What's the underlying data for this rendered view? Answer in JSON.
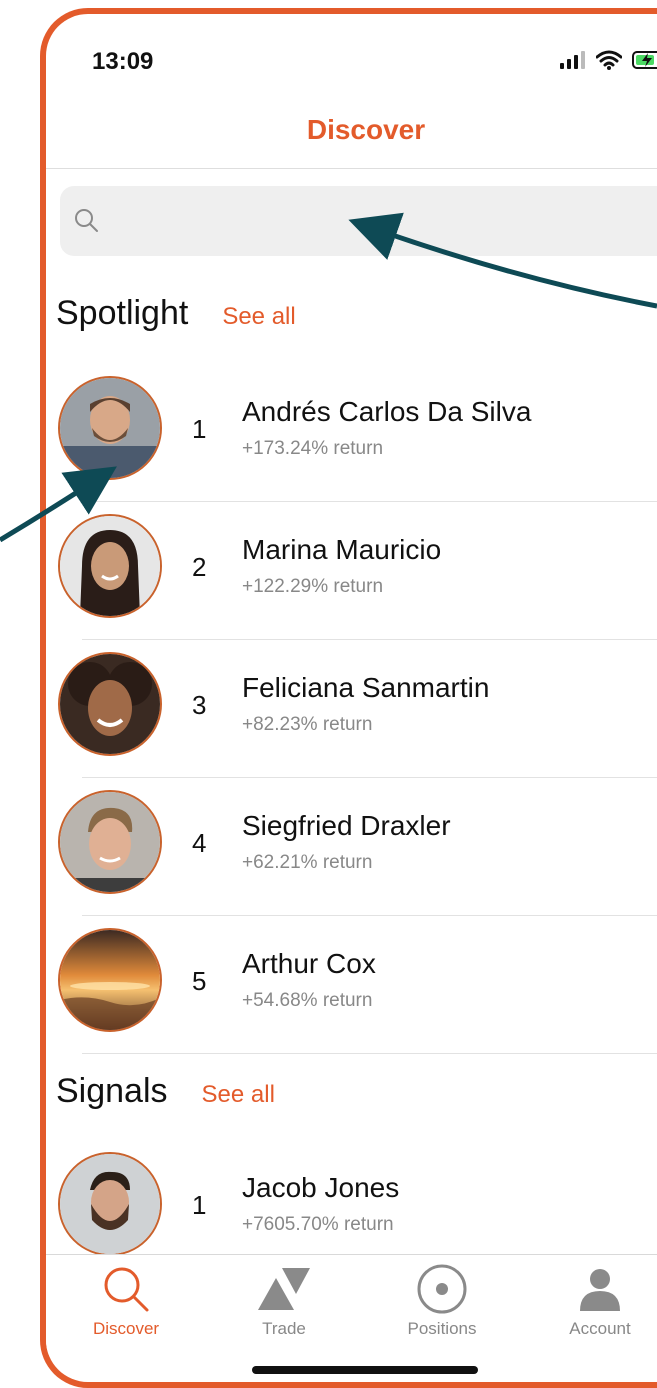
{
  "status_bar": {
    "time": "13:09"
  },
  "header": {
    "title": "Discover"
  },
  "search": {
    "placeholder": "",
    "value": ""
  },
  "spotlight": {
    "title": "Spotlight",
    "see_all": "See all",
    "items": [
      {
        "rank": "1",
        "name": "Andrés Carlos Da Silva",
        "return": "+173.24% return",
        "avatar": "man-portrait-avatar"
      },
      {
        "rank": "2",
        "name": "Marina Mauricio",
        "return": "+122.29% return",
        "avatar": "woman-portrait-avatar"
      },
      {
        "rank": "3",
        "name": "Feliciana Sanmartin",
        "return": "+82.23% return",
        "avatar": "woman-portrait-avatar"
      },
      {
        "rank": "4",
        "name": "Siegfried Draxler",
        "return": "+62.21% return",
        "avatar": "man-portrait-avatar"
      },
      {
        "rank": "5",
        "name": "Arthur Cox",
        "return": "+54.68% return",
        "avatar": "sunset-avatar"
      }
    ]
  },
  "signals": {
    "title": "Signals",
    "see_all": "See all",
    "items": [
      {
        "rank": "1",
        "name": "Jacob Jones",
        "return": "+7605.70% return",
        "avatar": "bearded-man-avatar"
      }
    ]
  },
  "tabbar": {
    "items": [
      {
        "label": "Discover",
        "icon": "search-icon",
        "active": true
      },
      {
        "label": "Trade",
        "icon": "triangles-icon",
        "active": false
      },
      {
        "label": "Positions",
        "icon": "target-circle-icon",
        "active": false
      },
      {
        "label": "Account",
        "icon": "person-icon",
        "active": false
      }
    ]
  },
  "colors": {
    "accent": "#e35b2b",
    "annotation_arrow": "#0e4a55",
    "secondary_text": "#888888"
  }
}
